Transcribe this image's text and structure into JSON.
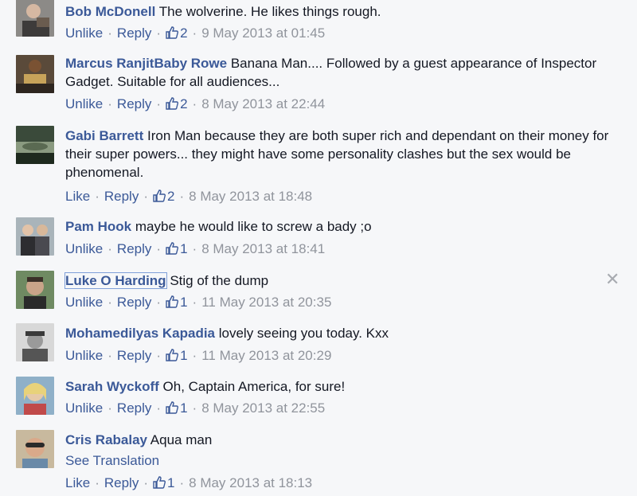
{
  "comments": [
    {
      "author": "Bob McDonell",
      "text": "The wolverine. He likes things rough.",
      "like_label": "Unlike",
      "reply_label": "Reply",
      "likes": "2",
      "timestamp": "9 May 2013 at 01:45"
    },
    {
      "author": "Marcus RanjitBaby Rowe",
      "text": "Banana Man.... Followed by a guest appearance of Inspector Gadget. Suitable for all audiences...",
      "like_label": "Unlike",
      "reply_label": "Reply",
      "likes": "2",
      "timestamp": "8 May 2013 at 22:44"
    },
    {
      "author": "Gabi Barrett",
      "text": "Iron Man because they are both super rich and dependant on their money for their super powers... they might have some personality clashes but the sex would be phenomenal.",
      "like_label": "Like",
      "reply_label": "Reply",
      "likes": "2",
      "timestamp": "8 May 2013 at 18:48"
    },
    {
      "author": "Pam Hook",
      "text": "maybe he would like to screw a bady ;o",
      "like_label": "Unlike",
      "reply_label": "Reply",
      "likes": "1",
      "timestamp": "8 May 2013 at 18:41"
    },
    {
      "author": "Luke O Harding",
      "text": "Stig of the dump",
      "like_label": "Unlike",
      "reply_label": "Reply",
      "likes": "1",
      "timestamp": "11 May 2013 at 20:35"
    },
    {
      "author": "Mohamedilyas Kapadia",
      "text": "lovely seeing you today. Kxx",
      "like_label": "Unlike",
      "reply_label": "Reply",
      "likes": "1",
      "timestamp": "11 May 2013 at 20:29"
    },
    {
      "author": "Sarah Wyckoff",
      "text": "Oh, Captain America, for sure!",
      "like_label": "Unlike",
      "reply_label": "Reply",
      "likes": "1",
      "timestamp": "8 May 2013 at 22:55"
    },
    {
      "author": "Cris Rabalay",
      "text": "Aqua man",
      "translate_label": "See Translation",
      "like_label": "Like",
      "reply_label": "Reply",
      "likes": "1",
      "timestamp": "8 May 2013 at 18:13"
    }
  ],
  "icons": {
    "close": "close-icon",
    "like": "thumbs-up-icon"
  },
  "colors": {
    "link": "#3b5998",
    "muted": "#90949c",
    "background": "#f6f7f9"
  }
}
